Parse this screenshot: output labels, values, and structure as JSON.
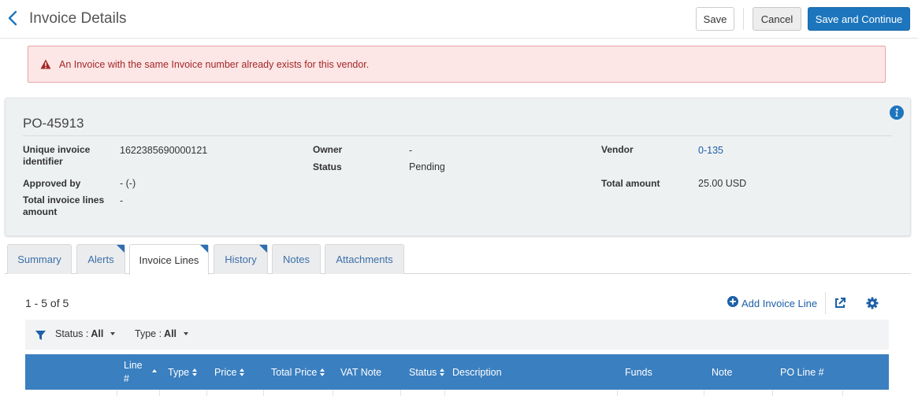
{
  "header": {
    "title": "Invoice Details",
    "save_label": "Save",
    "cancel_label": "Cancel",
    "save_continue_label": "Save and Continue"
  },
  "alert": {
    "message": "An Invoice with the same Invoice number already exists for this vendor."
  },
  "details": {
    "title": "PO-45913",
    "unique_id_label": "Unique invoice identifier",
    "unique_id_value": "1622385690000121",
    "approved_by_label": "Approved by",
    "approved_by_value": "- (-)",
    "total_lines_label": "Total invoice lines amount",
    "total_lines_value": "-",
    "owner_label": "Owner",
    "owner_value": "-",
    "status_label": "Status",
    "status_value": "Pending",
    "vendor_label": "Vendor",
    "vendor_value": "0-135",
    "total_amount_label": "Total amount",
    "total_amount_value": "25.00 USD"
  },
  "tabs": [
    {
      "label": "Summary",
      "active": false,
      "flag": false
    },
    {
      "label": "Alerts",
      "active": false,
      "flag": true
    },
    {
      "label": "Invoice Lines",
      "active": true,
      "flag": true
    },
    {
      "label": "History",
      "active": false,
      "flag": true
    },
    {
      "label": "Notes",
      "active": false,
      "flag": false
    },
    {
      "label": "Attachments",
      "active": false,
      "flag": false
    }
  ],
  "toolbar": {
    "count": "1 - 5 of 5",
    "add_line_label": "Add Invoice Line"
  },
  "filters": {
    "status_label": "Status :",
    "status_value": "All",
    "type_label": "Type :",
    "type_value": "All"
  },
  "table": {
    "columns": [
      "Line #",
      "Type",
      "Price",
      "Total Price",
      "VAT Note",
      "Status",
      "Description",
      "Funds",
      "Note",
      "PO Line #"
    ]
  },
  "colors": {
    "primary": "#1d76bd",
    "link": "#1d5fa8",
    "alert_bg": "#fce6e6",
    "alert_text": "#a52727",
    "table_header": "#3a7fc0"
  },
  "icons": [
    "chevron-left-icon",
    "warning-icon",
    "info-icon",
    "plus-circle-icon",
    "external-link-icon",
    "gear-icon",
    "filter-icon"
  ]
}
